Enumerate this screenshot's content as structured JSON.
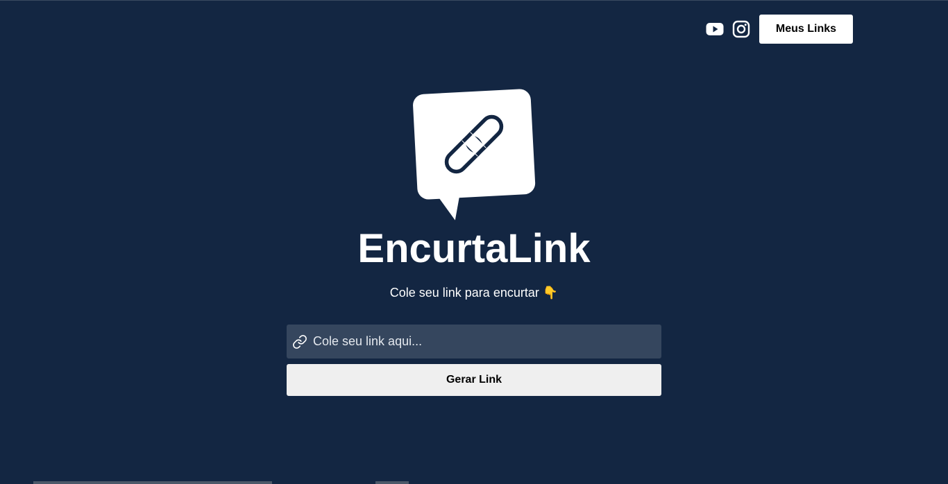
{
  "header": {
    "youtube_icon": "youtube-icon",
    "instagram_icon": "instagram-icon",
    "meus_links_label": "Meus Links"
  },
  "logo": {
    "icon": "chat-bubble-link-icon"
  },
  "hero": {
    "title": "EncurtaLink",
    "subtitle": "Cole seu link para encurtar 👇"
  },
  "form": {
    "input_icon": "link-icon",
    "input_placeholder": "Cole seu link aqui...",
    "input_value": "",
    "submit_label": "Gerar Link"
  },
  "colors": {
    "background": "#132642",
    "input_background": "#35465e",
    "button_background": "#efefef",
    "text": "#ffffff"
  }
}
